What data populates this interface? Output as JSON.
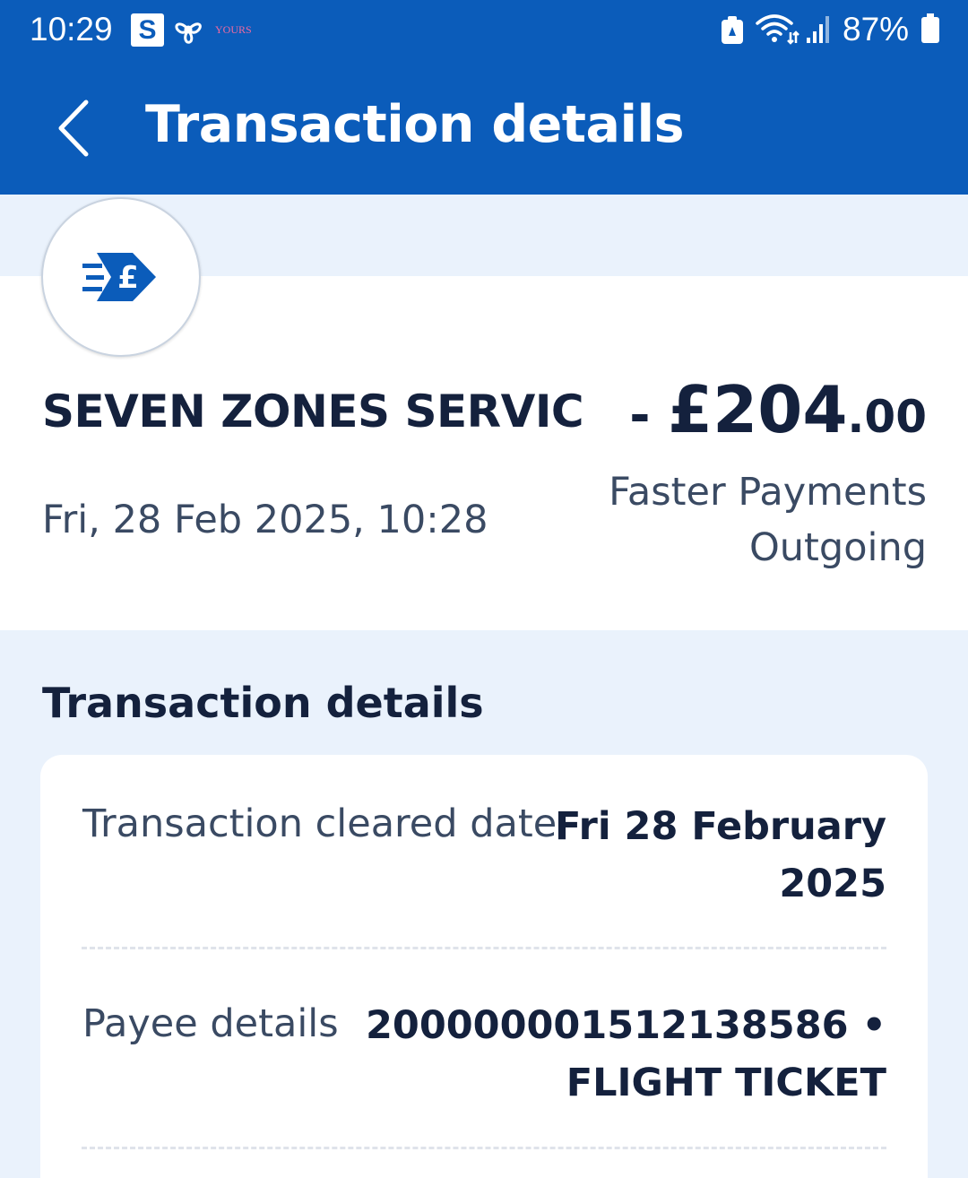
{
  "status_bar": {
    "time": "10:29",
    "s_icon_label": "S",
    "tiny_app_label": "YOURS",
    "battery_percent": "87%",
    "icons": [
      "s-app-icon",
      "fan-icon",
      "lock-icon",
      "wifi-icon",
      "signal-icon",
      "battery-icon"
    ]
  },
  "app_bar": {
    "title": "Transaction details",
    "back_icon": "chevron-left-icon"
  },
  "summary": {
    "payee_icon": "faster-payment-pound-icon",
    "payee_name": "SEVEN ZONES SERVIC",
    "amount_sign": "- ",
    "amount_main": "£204",
    "amount_pence": ".00",
    "date": "Fri, 28 Feb 2025, 10:28",
    "type_line1": "Faster Payments",
    "type_line2": "Outgoing"
  },
  "details": {
    "section_title": "Transaction details",
    "rows": [
      {
        "label": "Transaction cleared date",
        "value_line1": "Fri 28 February",
        "value_line2": "2025"
      },
      {
        "label": "Payee details",
        "value_line1": "20000000151213858​6 •",
        "value_line2": "FLIGHT TICKET"
      }
    ]
  },
  "colors": {
    "brand_blue": "#0b5cba",
    "page_bg": "#eaf2fc",
    "text_dark": "#14213d",
    "text_muted": "#3a4a63"
  }
}
